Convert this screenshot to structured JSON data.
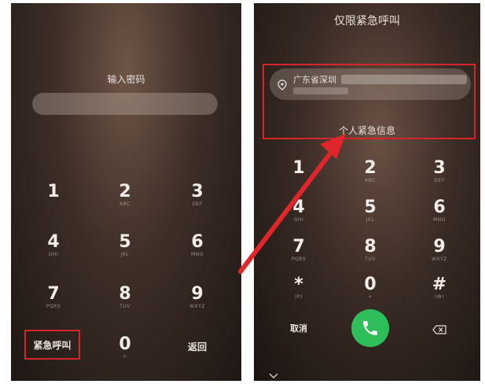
{
  "left_screen": {
    "title": "输入密码",
    "keypad": [
      {
        "digit": "1",
        "letters": ""
      },
      {
        "digit": "2",
        "letters": "ABC"
      },
      {
        "digit": "3",
        "letters": "DEF"
      },
      {
        "digit": "4",
        "letters": "GHI"
      },
      {
        "digit": "5",
        "letters": "JKL"
      },
      {
        "digit": "6",
        "letters": "MNO"
      },
      {
        "digit": "7",
        "letters": "PQRS"
      },
      {
        "digit": "8",
        "letters": "TUV"
      },
      {
        "digit": "9",
        "letters": "WXYZ"
      }
    ],
    "emergency_label": "紧急呼叫",
    "zero": {
      "digit": "0",
      "letters": "+"
    },
    "back_label": "返回"
  },
  "right_screen": {
    "title": "仅限紧急呼叫",
    "location_text": "广东省深圳",
    "personal_info_label": "个人紧急信息",
    "keypad": [
      {
        "digit": "1",
        "letters": ""
      },
      {
        "digit": "2",
        "letters": "ABC"
      },
      {
        "digit": "3",
        "letters": "DEF"
      },
      {
        "digit": "4",
        "letters": "GHI"
      },
      {
        "digit": "5",
        "letters": "JKL"
      },
      {
        "digit": "6",
        "letters": "MNO"
      },
      {
        "digit": "7",
        "letters": "PQRS"
      },
      {
        "digit": "8",
        "letters": "TUV"
      },
      {
        "digit": "9",
        "letters": "WXYZ"
      },
      {
        "digit": "*",
        "letters": "(P)"
      },
      {
        "digit": "0",
        "letters": "+"
      },
      {
        "digit": "#",
        "letters": "(W)"
      }
    ],
    "cancel_label": "取消"
  },
  "colors": {
    "highlight": "#d5242a",
    "call_button": "#2fbf5a"
  }
}
